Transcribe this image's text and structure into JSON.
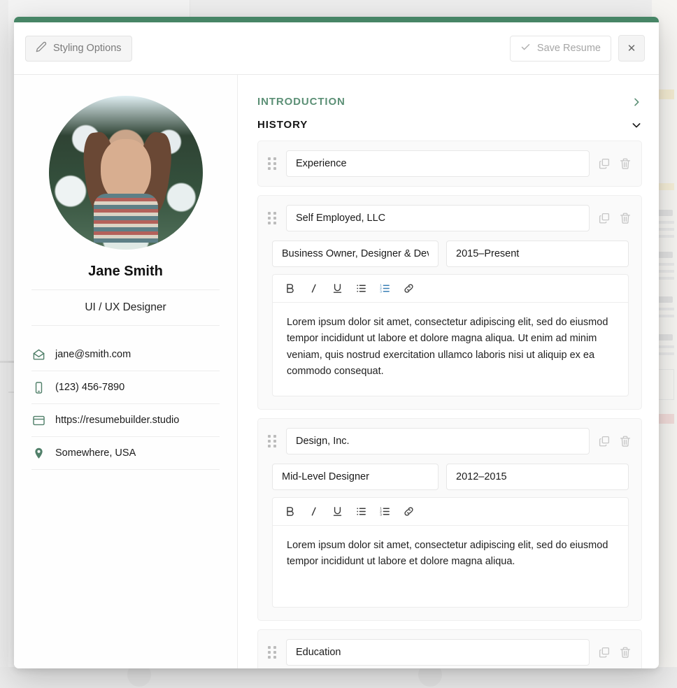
{
  "theme": {
    "accent_green": "#478566",
    "heading_green": "#5c9076",
    "toolbar_active_blue": "#3a7fb5"
  },
  "toolbar": {
    "styling_options_label": "Styling Options",
    "save_resume_label": "Save Resume",
    "close_label": "✕"
  },
  "profile": {
    "name": "Jane Smith",
    "role": "UI / UX Designer",
    "contacts": [
      {
        "icon": "email-icon",
        "text": "jane@smith.com"
      },
      {
        "icon": "phone-icon",
        "text": "(123) 456-7890"
      },
      {
        "icon": "website-icon",
        "text": "https://resumebuilder.studio"
      },
      {
        "icon": "location-icon",
        "text": "Somewhere, USA"
      }
    ]
  },
  "sections": [
    {
      "label": "INTRODUCTION",
      "state": "collapsed",
      "chevron": "chevron-right-icon"
    },
    {
      "label": "HISTORY",
      "state": "expanded",
      "chevron": "chevron-down-icon"
    }
  ],
  "history": {
    "group_title": "Experience",
    "group_title_2": "Education",
    "entries": [
      {
        "organization": "Self Employed, LLC",
        "position": "Business Owner, Designer & Dev",
        "dates": "2015–Present",
        "description": "Lorem ipsum dolor sit amet, consectetur adipiscing elit, sed do eiusmod tempor incididunt ut labore et dolore magna aliqua. Ut enim ad minim veniam, quis nostrud exercitation ullamco laboris nisi ut aliquip ex ea commodo consequat."
      },
      {
        "organization": "Design, Inc.",
        "position": "Mid-Level Designer",
        "dates": "2012–2015",
        "description": "Lorem ipsum dolor sit amet, consectetur adipiscing elit, sed do eiusmod tempor incididunt ut labore et dolore magna aliqua."
      }
    ]
  },
  "editor_toolbar": {
    "bold": "B",
    "italic": "I",
    "underline": "U",
    "bullet_list": "bullet-list-icon",
    "numbered_list": "numbered-list-icon",
    "link": "link-icon"
  },
  "row_actions": {
    "duplicate": "copy-icon",
    "delete": "trash-icon"
  }
}
